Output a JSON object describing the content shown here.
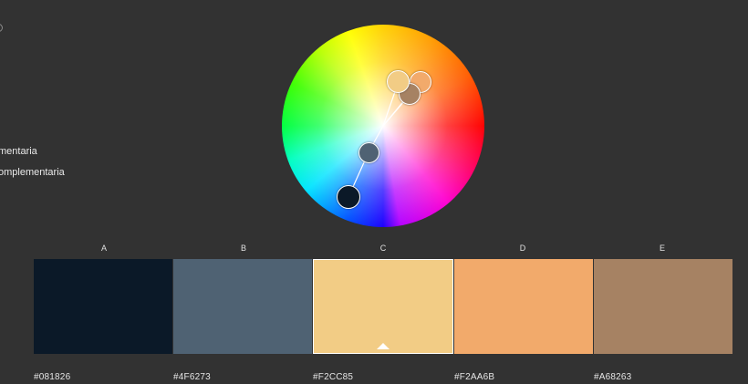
{
  "harmony_rules": {
    "items": [
      {
        "label": "mentaria"
      },
      {
        "label": "omplementaria"
      }
    ]
  },
  "palette": {
    "swatches": [
      {
        "letter": "A",
        "hex": "#081826",
        "color": "#0b1928"
      },
      {
        "letter": "B",
        "hex": "#4F6273",
        "color": "#4f6273"
      },
      {
        "letter": "C",
        "hex": "#F2CC85",
        "color": "#f2cc85",
        "selected": true
      },
      {
        "letter": "D",
        "hex": "#F2AA6B",
        "color": "#f2aa6b"
      },
      {
        "letter": "E",
        "hex": "#A68263",
        "color": "#a68263"
      }
    ]
  }
}
